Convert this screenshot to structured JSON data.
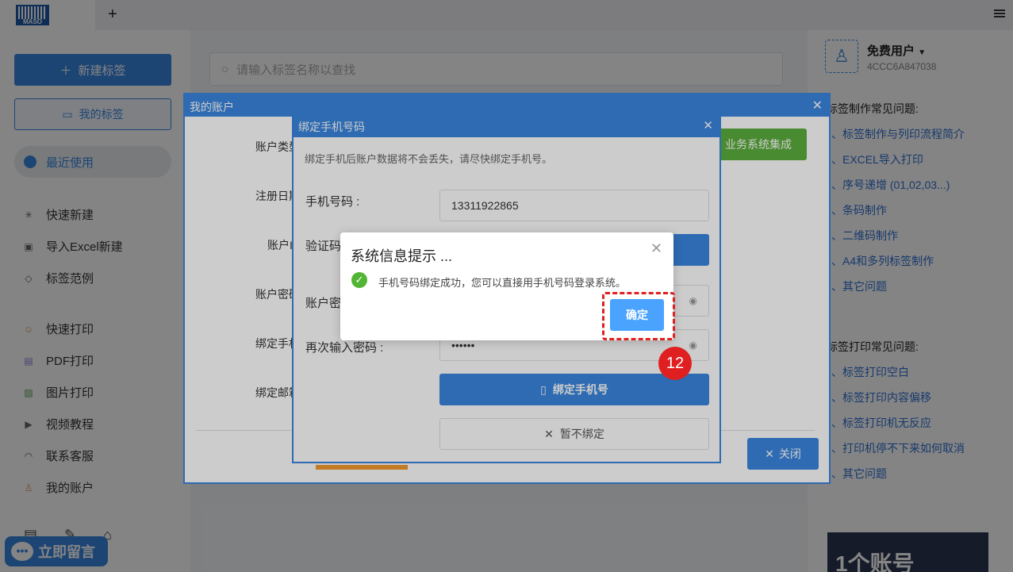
{
  "titlebar": {
    "logo_text": "MASO",
    "add_tab": "+"
  },
  "sidebar": {
    "new_label": "新建标签",
    "my_labels": "我的标签",
    "recent": "最近使用",
    "items": [
      {
        "label": "快速新建",
        "icon": "sparkle-icon"
      },
      {
        "label": "导入Excel新建",
        "icon": "excel-icon"
      },
      {
        "label": "标签范例",
        "icon": "box-icon"
      },
      {
        "label": "快速打印",
        "icon": "printer-icon"
      },
      {
        "label": "PDF打印",
        "icon": "pdf-icon"
      },
      {
        "label": "图片打印",
        "icon": "image-icon"
      },
      {
        "label": "视频教程",
        "icon": "video-icon"
      },
      {
        "label": "联系客服",
        "icon": "headset-icon"
      },
      {
        "label": "我的账户",
        "icon": "user-icon"
      }
    ],
    "chat_label": "立即留言"
  },
  "search": {
    "placeholder": "请输入标签名称以查找"
  },
  "user": {
    "name": "免费用户",
    "id": "4CCC6A847038"
  },
  "faq": {
    "make_title": "标签制作常见问题:",
    "make_items": [
      "、标签制作与列印流程简介",
      "、EXCEL导入打印",
      "、序号递增 (01,02,03...)",
      "、条码制作",
      "、二维码制作",
      "、A4和多列标签制作",
      "、其它问题"
    ],
    "print_title": "标签打印常见问题:",
    "print_items": [
      "、标签打印空白",
      "、标签打印内容偏移",
      "、标签打印机无反应",
      "、打印机停不下来如何取消",
      "、其它问题"
    ]
  },
  "promo": {
    "text": "1个账号"
  },
  "account_dialog": {
    "title": "我的账户",
    "labels": [
      "账户类型",
      "注册日期",
      "账户ID",
      "账户密码",
      "绑定手机",
      "绑定邮箱"
    ],
    "biz_button": "业务系统集成",
    "close_button": "关闭"
  },
  "phone_dialog": {
    "title": "绑定手机号码",
    "note": "绑定手机后账户数据将不会丢失，请尽快绑定手机号。",
    "phone_label": "手机号码 :",
    "phone_value": "13311922865",
    "code_label": "验证码",
    "password_label": "账户密码",
    "repeat_label": "再次输入密码 :",
    "repeat_value": "••••••",
    "bind_button": "绑定手机号",
    "skip_button": "暂不绑定"
  },
  "message_box": {
    "title": "系统信息提示 ...",
    "message": "手机号码绑定成功，您可以直接用手机号码登录系统。",
    "confirm": "确定"
  },
  "annotation": {
    "step": "12",
    "color": "#e02020"
  }
}
